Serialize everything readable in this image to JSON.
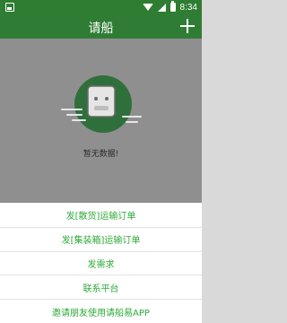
{
  "status_bar": {
    "time": "8:34"
  },
  "app_bar": {
    "title": "请船"
  },
  "empty_state": {
    "text": "暂无数据!"
  },
  "action_sheet": {
    "items": [
      {
        "label": "发[散货]运输订单"
      },
      {
        "label": "发[集装箱]运输订单"
      },
      {
        "label": "发需求"
      },
      {
        "label": "联系平台"
      },
      {
        "label": "邀请朋友使用请船易APP"
      }
    ]
  },
  "colors": {
    "primary": "#2f7d35",
    "accent_text": "#2eaa38",
    "dim_overlay": "#8f8f8f"
  }
}
